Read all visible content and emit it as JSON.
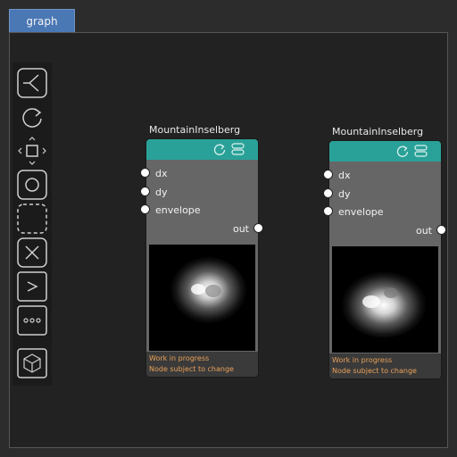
{
  "tab": {
    "label": "graph"
  },
  "toolbar": {
    "tools": [
      {
        "name": "split-icon"
      },
      {
        "name": "refresh-icon"
      },
      {
        "name": "move-icon"
      },
      {
        "name": "circle-icon"
      },
      {
        "name": "select-region-icon"
      },
      {
        "name": "close-icon"
      },
      {
        "name": "chevron-right-icon"
      },
      {
        "name": "more-icon"
      },
      {
        "name": "cube-icon"
      }
    ]
  },
  "nodes": [
    {
      "title": "MountainInselberg",
      "inputs": [
        "dx",
        "dy",
        "envelope"
      ],
      "output": "out",
      "footer": [
        "Work in progress",
        "Node subject to change"
      ]
    },
    {
      "title": "MountainInselberg",
      "inputs": [
        "dx",
        "dy",
        "envelope"
      ],
      "output": "out",
      "footer": [
        "Work in progress",
        "Node subject to change"
      ]
    }
  ],
  "colors": {
    "tab": "#4a78b5",
    "node_header": "#2aa198",
    "node_body": "#666666",
    "footer_text": "#e8a15a"
  }
}
